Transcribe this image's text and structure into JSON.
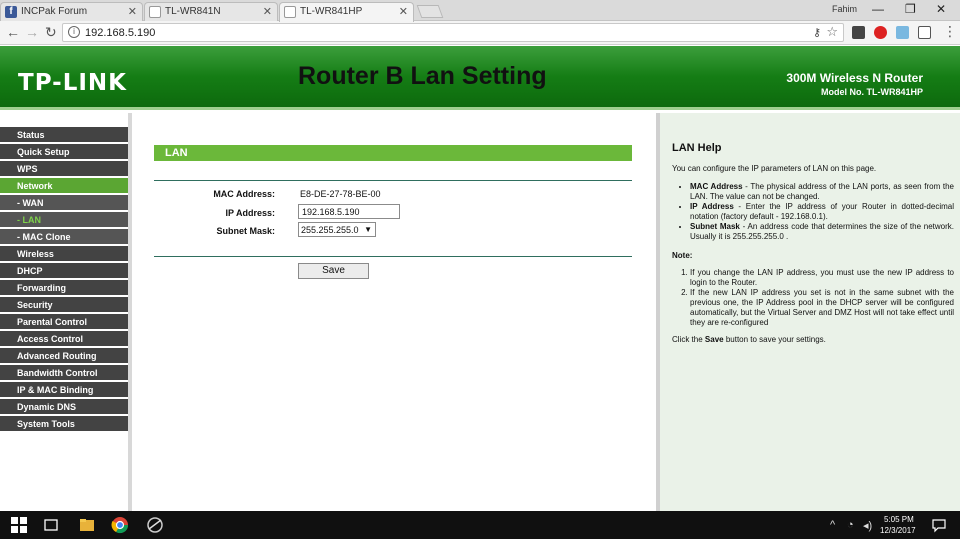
{
  "browser": {
    "tabs": [
      {
        "label": "INCPak Forum",
        "favicon": "facebook-icon"
      },
      {
        "label": "TL-WR841N",
        "favicon": "page-icon"
      },
      {
        "label": "TL-WR841HP",
        "favicon": "page-icon"
      }
    ],
    "user": "Fahim",
    "url": "192.168.5.190"
  },
  "router": {
    "logo": "TP-LINK",
    "title": "Router B Lan Setting",
    "product": "300M Wireless N Router",
    "model": "Model No. TL-WR841HP",
    "brand_color": "#0d6a0d",
    "menu": [
      "Status",
      "Quick Setup",
      "WPS",
      "Network",
      "- WAN",
      "- LAN",
      "- MAC Clone",
      "Wireless",
      "DHCP",
      "Forwarding",
      "Security",
      "Parental Control",
      "Access Control",
      "Advanced Routing",
      "Bandwidth Control",
      "IP & MAC Binding",
      "Dynamic DNS",
      "System Tools"
    ],
    "active_menu": "Network",
    "active_submenu": "- LAN"
  },
  "lan": {
    "section_title": "LAN",
    "mac_label": "MAC Address:",
    "mac_value": "E8-DE-27-78-BE-00",
    "ip_label": "IP Address:",
    "ip_value": "192.168.5.190",
    "mask_label": "Subnet Mask:",
    "mask_value": "255.255.255.0",
    "save_label": "Save"
  },
  "help": {
    "title": "LAN Help",
    "intro": "You can configure the IP parameters of LAN on this page.",
    "items": [
      {
        "term": "MAC Address",
        "text": " - The physical address of the LAN ports, as seen from the LAN. The value can not be changed."
      },
      {
        "term": "IP Address",
        "text": " - Enter the IP address of your Router in dotted-decimal notation (factory default - 192.168.0.1)."
      },
      {
        "term": "Subnet Mask",
        "text": " - An address code that determines the size of the network. Usually it is 255.255.255.0 ."
      }
    ],
    "note_label": "Note",
    "notes": [
      "If you change the LAN IP address, you must use the new IP address to login to the Router.",
      "If the new LAN IP address you set is not in the same subnet with the previous one, the IP Address pool in the DHCP server will be configured automatically, but the Virtual Server and DMZ Host will not take effect until they are re-configured"
    ],
    "bottom_before": "Click the ",
    "bottom_bold": "Save",
    "bottom_after": " button to save your settings."
  },
  "taskbar": {
    "time": "5:05 PM",
    "date": "12/3/2017"
  }
}
